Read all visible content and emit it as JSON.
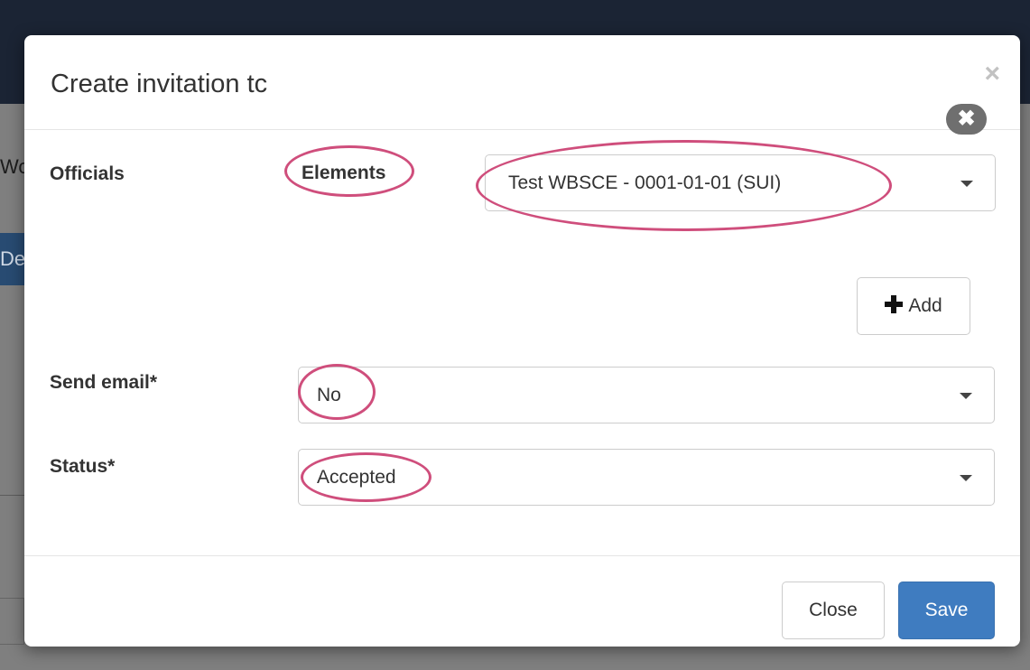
{
  "background": {
    "frag_text": "Wo",
    "frag_button": "Desi"
  },
  "modal": {
    "title": "Create invitation tc",
    "close_glyph": "×"
  },
  "form": {
    "officials_label": "Officials",
    "elements_label": "Elements",
    "elements_value": "Test WBSCE - 0001-01-01 (SUI)",
    "remove_glyph": "✖",
    "add_label": "Add",
    "send_email_label": "Send email*",
    "send_email_value": "No",
    "status_label": "Status*",
    "status_value": "Accepted"
  },
  "footer": {
    "close_label": "Close",
    "save_label": "Save"
  },
  "colors": {
    "annotation": "#cf4e7c",
    "primary": "#3f7cc0"
  }
}
